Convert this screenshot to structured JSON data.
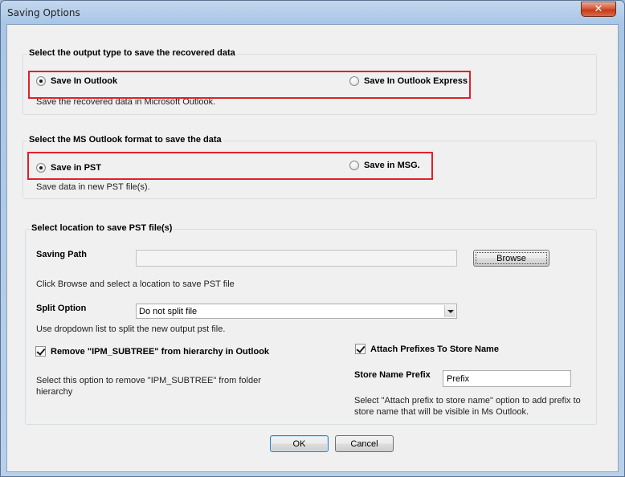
{
  "window": {
    "title": "Saving Options",
    "close_label": "✕"
  },
  "output_type": {
    "title": "Select the output type to save the recovered data",
    "option_outlook": "Save In Outlook",
    "option_outlook_express": "Save In Outlook Express",
    "selected": "outlook",
    "description": "Save the recovered data in Microsoft Outlook."
  },
  "format": {
    "title": "Select the MS Outlook format to save the data",
    "option_pst": "Save in PST",
    "option_msg": "Save in MSG.",
    "selected": "pst",
    "description": "Save data in new PST file(s)."
  },
  "location": {
    "title": "Select location to save PST file(s)",
    "saving_path_label": "Saving Path",
    "saving_path_value": "",
    "browse_label": "Browse",
    "browse_hint": "Click Browse and select a location to save PST file",
    "split_label": "Split Option",
    "split_value": "Do not split file",
    "split_hint": "Use dropdown list to split the new output pst file.",
    "remove_subtree_label": "Remove \"IPM_SUBTREE\" from hierarchy in Outlook",
    "remove_subtree_checked": true,
    "remove_subtree_hint": "Select this option to remove \"IPM_SUBTREE\" from folder hierarchy",
    "attach_prefix_label": "Attach Prefixes To Store Name",
    "attach_prefix_checked": true,
    "store_prefix_label": "Store Name Prefix",
    "store_prefix_value": "Prefix",
    "store_prefix_hint": "Select \"Attach prefix to store name\" option to add prefix to store name that will be visible in Ms Outlook."
  },
  "footer": {
    "ok_label": "OK",
    "cancel_label": "Cancel"
  },
  "colors": {
    "highlight": "#e0202c",
    "close_button": "#c43a1a"
  }
}
